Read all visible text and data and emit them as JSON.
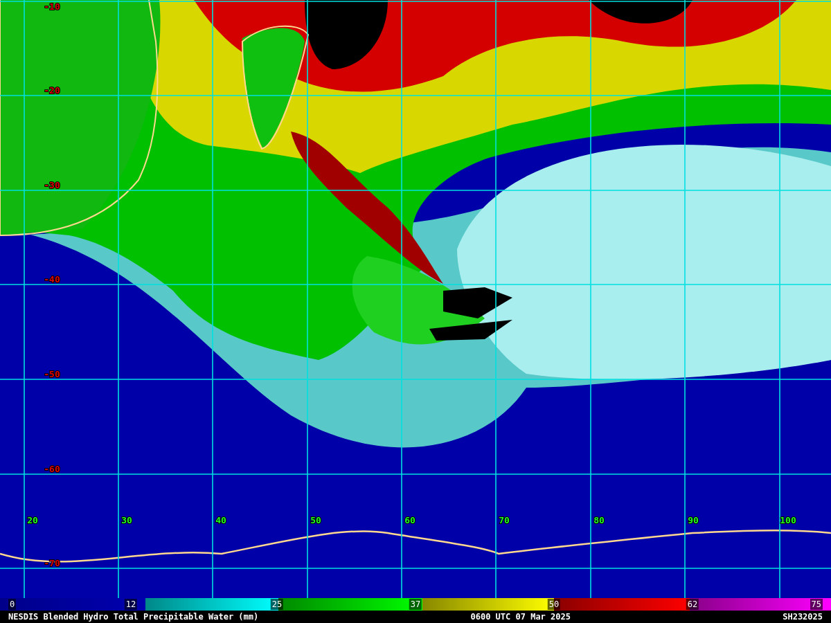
{
  "map": {
    "latitude_labels": [
      "-10",
      "-20",
      "-30",
      "-40",
      "-50",
      "-60",
      "-70"
    ],
    "longitude_labels": [
      "20",
      "30",
      "40",
      "50",
      "60",
      "70",
      "80",
      "90",
      "100"
    ]
  },
  "color_scale": {
    "ticks": [
      "0",
      "12",
      "25",
      "37",
      "50",
      "62",
      "75"
    ]
  },
  "footer": {
    "title": "NESDIS Blended Hydro Total Precipitable Water (mm)",
    "time": "0600 UTC 07 Mar 2025",
    "storm_id": "SH232025"
  }
}
